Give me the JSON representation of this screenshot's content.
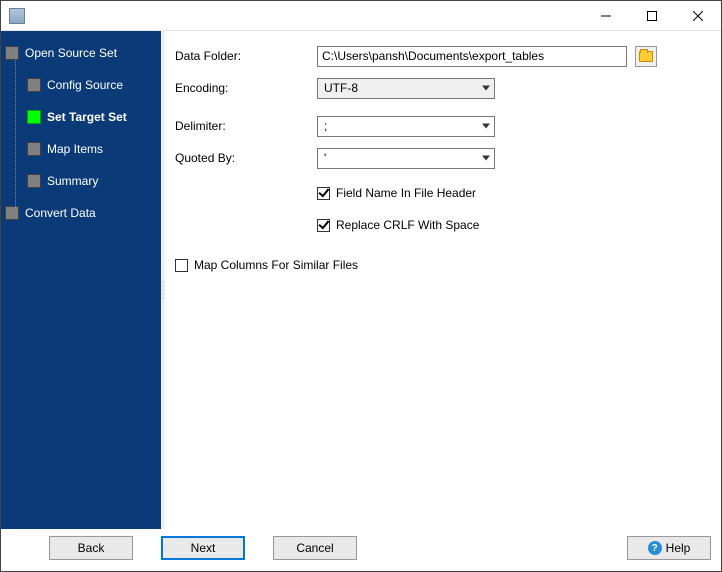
{
  "titlebar": {
    "title": ""
  },
  "sidebar": {
    "root1": "Open Source Set",
    "children": [
      "Config Source",
      "Set Target Set",
      "Map Items",
      "Summary"
    ],
    "active_index": 1,
    "root2": "Convert Data"
  },
  "form": {
    "data_folder_label": "Data Folder:",
    "data_folder_value": "C:\\Users\\pansh\\Documents\\export_tables",
    "encoding_label": "Encoding:",
    "encoding_value": "UTF-8",
    "delimiter_label": "Delimiter:",
    "delimiter_value": ";",
    "quoted_label": "Quoted By:",
    "quoted_value": "'",
    "check1_label": "Field Name In File Header",
    "check1_checked": true,
    "check2_label": "Replace CRLF With Space",
    "check2_checked": true,
    "check3_label": "Map Columns For Similar Files",
    "check3_checked": false
  },
  "footer": {
    "back": "Back",
    "next": "Next",
    "cancel": "Cancel",
    "help": "Help"
  }
}
